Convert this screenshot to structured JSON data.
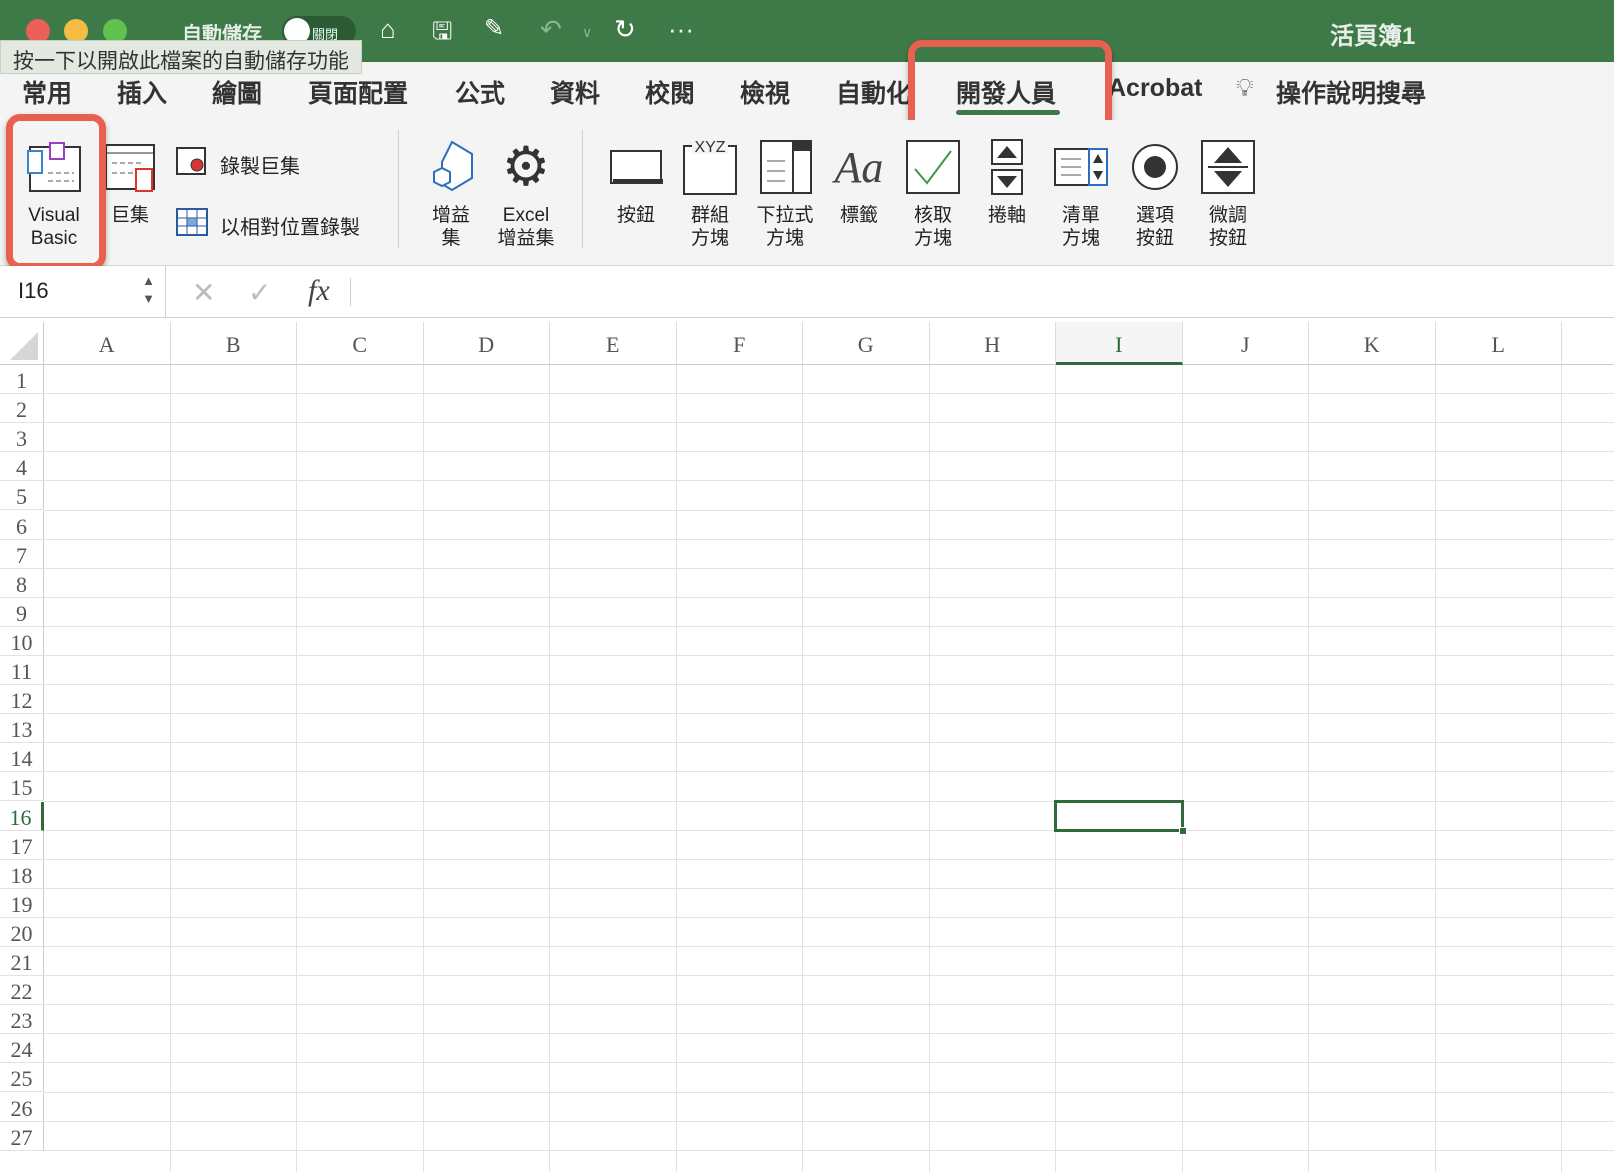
{
  "titlebar": {
    "autosave_label": "自動儲存",
    "autosave_state": "關閉",
    "workbook_title": "活頁簿1",
    "tooltip": "按一下以開啟此檔案的自動儲存功能"
  },
  "tabs": [
    {
      "label": "常用"
    },
    {
      "label": "插入"
    },
    {
      "label": "繪圖"
    },
    {
      "label": "頁面配置"
    },
    {
      "label": "公式"
    },
    {
      "label": "資料"
    },
    {
      "label": "校閱"
    },
    {
      "label": "檢視"
    },
    {
      "label": "自動化"
    },
    {
      "label": "開發人員",
      "active": true
    },
    {
      "label": "Acrobat"
    },
    {
      "label": "操作說明搜尋"
    }
  ],
  "ribbon": {
    "visual_basic": "Visual Basic",
    "macros": "巨集",
    "record_macro": "錄製巨集",
    "relative_record": "以相對位置錄製",
    "addins": "增益集",
    "excel_addins": "Excel 增益集",
    "button": "按鈕",
    "group_box": "群組方塊",
    "combo_box": "下拉式方塊",
    "label": "標籤",
    "check_box": "核取方塊",
    "scroll_bar": "捲軸",
    "list_box": "清單方塊",
    "option_button": "選項按鈕",
    "spinner": "微調按鈕"
  },
  "formula_bar": {
    "name_box": "I16",
    "fx": "fx",
    "value": ""
  },
  "sheet": {
    "columns": [
      "A",
      "B",
      "C",
      "D",
      "E",
      "F",
      "G",
      "H",
      "I",
      "J",
      "K",
      "L"
    ],
    "rows": [
      "1",
      "2",
      "3",
      "4",
      "5",
      "6",
      "7",
      "8",
      "9",
      "10",
      "11",
      "12",
      "13",
      "14",
      "15",
      "16",
      "17",
      "18",
      "19",
      "20",
      "21",
      "22",
      "23",
      "24",
      "25",
      "26",
      "27"
    ],
    "selected_cell": "I16"
  },
  "colors": {
    "accent": "#3d7a48",
    "highlight": "#e8604f"
  }
}
